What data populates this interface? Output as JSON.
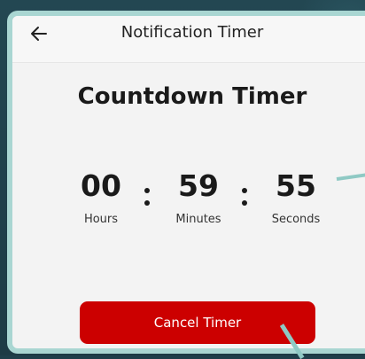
{
  "app_bar": {
    "title": "Notification Timer",
    "back_icon": "arrow-left-icon"
  },
  "timer": {
    "heading": "Countdown Timer",
    "hours": {
      "value": "00",
      "label": "Hours"
    },
    "minutes": {
      "value": "59",
      "label": "Minutes"
    },
    "seconds": {
      "value": "55",
      "label": "Seconds"
    }
  },
  "actions": {
    "cancel_label": "Cancel Timer"
  },
  "colors": {
    "accent_button": "#cc0000",
    "frame": "#a9d6d2",
    "background": "#1f3f4a"
  }
}
